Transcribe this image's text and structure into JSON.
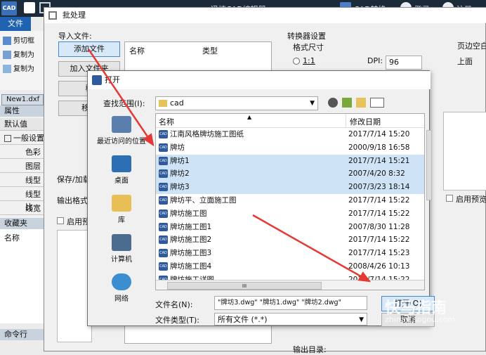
{
  "app": {
    "logo_text": "CAD",
    "titlebar_text": "迅捷CAD编辑器",
    "titlebar_right": "CAD转换",
    "titlebar_user": "登录",
    "titlebar_extra": "注册"
  },
  "ribbon": {
    "file_tab": "文件",
    "items": [
      "剪切框",
      "复制为",
      "复制为"
    ]
  },
  "left": {
    "doc_tab": "New1.dxf",
    "prop_header": "属性",
    "default_header": "默认值",
    "group_header": "一般设置",
    "props": [
      "色彩",
      "图层",
      "线型",
      "线型比",
      "线宽"
    ],
    "fav_header": "收藏夹",
    "fav_col": "名称",
    "cmd_header": "命令行"
  },
  "batch": {
    "title": "批处理",
    "import_label": "导入文件:",
    "add_file": "添加文件",
    "add_folder": "加入文件夹",
    "remove": "移",
    "remove2": "移除",
    "col_name": "名称",
    "col_type": "类型",
    "save_label": "保存/加载",
    "output_format": "输出格式",
    "enable_preview_left": "启用预",
    "converter_settings": "转换器设置",
    "format_size": "格式尺寸",
    "ratio": "1:1",
    "dpi_label": "DPI:",
    "dpi_value": "96",
    "page_margin": "页边空白",
    "top_margin": "上面",
    "enable_preview": "启用预览",
    "output_dir": "输出目录:"
  },
  "open_dialog": {
    "title": "打开",
    "look_in_label": "查找范围(I):",
    "look_in_value": "cad",
    "places": [
      "最近访问的位置",
      "桌面",
      "库",
      "计算机",
      "网络"
    ],
    "col_name": "名称",
    "col_date": "修改日期",
    "files": [
      {
        "name": "江南风格牌坊施工图纸",
        "date": "2017/7/14 15:20",
        "selected": false
      },
      {
        "name": "牌坊",
        "date": "2000/9/18 16:58",
        "selected": false
      },
      {
        "name": "牌坊1",
        "date": "2017/7/14 15:21",
        "selected": true
      },
      {
        "name": "牌坊2",
        "date": "2007/4/20 8:32",
        "selected": true
      },
      {
        "name": "牌坊3",
        "date": "2007/3/23 18:14",
        "selected": true
      },
      {
        "name": "牌坊平、立面施工图",
        "date": "2017/7/14 15:22",
        "selected": false
      },
      {
        "name": "牌坊施工图",
        "date": "2017/7/14 15:22",
        "selected": false
      },
      {
        "name": "牌坊施工图1",
        "date": "2007/8/30 11:28",
        "selected": false
      },
      {
        "name": "牌坊施工图2",
        "date": "2017/7/14 15:22",
        "selected": false
      },
      {
        "name": "牌坊施工图3",
        "date": "2017/7/14 15:23",
        "selected": false
      },
      {
        "name": "牌坊施工图4",
        "date": "2008/4/26 10:13",
        "selected": false
      },
      {
        "name": "牌坊施工详图",
        "date": "2017/7/14 15:22",
        "selected": false
      }
    ],
    "filename_label": "文件名(N):",
    "filename_value": "\"牌坊3.dwg\" \"牌坊1.dwg\" \"牌坊2.dwg\"",
    "filetype_label": "文件类型(T):",
    "filetype_value": "所有文件 (*.*)",
    "open_button": "打开(O)",
    "cancel_button": "取消",
    "scroll_mark": "III"
  },
  "watermark": {
    "text": "快马指南",
    "sub": "zhinan.sogou.com"
  },
  "colors": {
    "accent": "#3f8ad3",
    "arrow": "#e53935",
    "selection": "#cfe3f7"
  }
}
